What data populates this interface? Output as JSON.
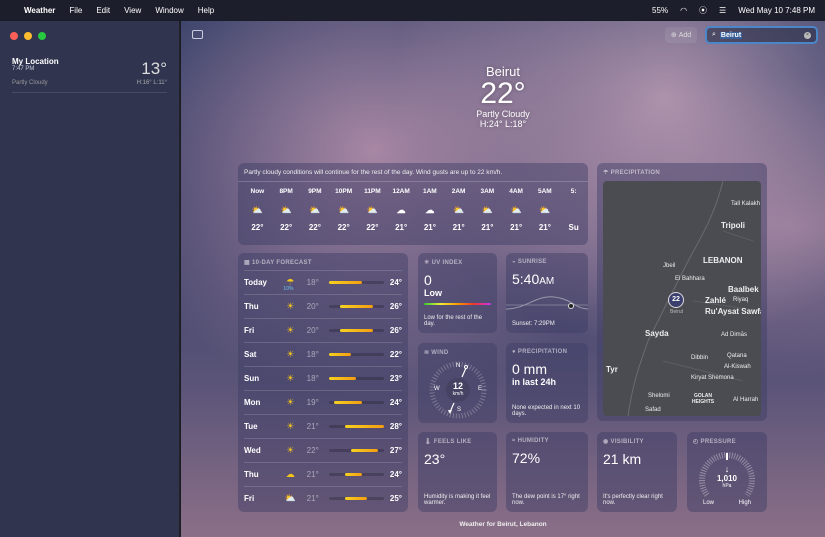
{
  "menubar": {
    "app": "Weather",
    "items": [
      "File",
      "Edit",
      "View",
      "Window",
      "Help"
    ],
    "battery": "55%",
    "datetime": "Wed May 10  7:48 PM"
  },
  "sidebar": {
    "location": {
      "name": "My Location",
      "time": "7:47 PM",
      "condition": "Partly Cloudy",
      "temp": "13°",
      "hilo": "H:16°  L:11°"
    }
  },
  "toolbar": {
    "add_label": "Add",
    "search_value": "Beirut"
  },
  "hero": {
    "city": "Beirut",
    "temp": "22°",
    "condition": "Partly Cloudy",
    "hilo": "H:24°  L:18°"
  },
  "hourly": {
    "summary": "Partly cloudy conditions will continue for the rest of the day. Wind gusts are up to 22 km/h.",
    "hours": [
      {
        "t": "Now",
        "i": "partly-cloudy",
        "v": "22°"
      },
      {
        "t": "8PM",
        "i": "partly-cloudy",
        "v": "22°"
      },
      {
        "t": "9PM",
        "i": "partly-cloudy",
        "v": "22°"
      },
      {
        "t": "10PM",
        "i": "partly-cloudy",
        "v": "22°"
      },
      {
        "t": "11PM",
        "i": "partly-cloudy",
        "v": "22°"
      },
      {
        "t": "12AM",
        "i": "cloudy",
        "v": "21°"
      },
      {
        "t": "1AM",
        "i": "cloudy",
        "v": "21°"
      },
      {
        "t": "2AM",
        "i": "partly-cloudy",
        "v": "21°"
      },
      {
        "t": "3AM",
        "i": "partly-cloudy",
        "v": "21°"
      },
      {
        "t": "4AM",
        "i": "partly-cloudy",
        "v": "21°"
      },
      {
        "t": "5AM",
        "i": "partly-cloudy",
        "v": "21°"
      },
      {
        "t": "5:",
        "i": "",
        "v": "Su"
      }
    ]
  },
  "forecast": {
    "title": "10-DAY FORECAST",
    "days": [
      {
        "d": "Today",
        "i": "rain",
        "p": "10%",
        "lo": 18,
        "hi": 24,
        "lo_s": "18°",
        "hi_s": "24°"
      },
      {
        "d": "Thu",
        "i": "sun",
        "lo": 20,
        "hi": 26,
        "lo_s": "20°",
        "hi_s": "26°"
      },
      {
        "d": "Fri",
        "i": "sun",
        "lo": 20,
        "hi": 26,
        "lo_s": "20°",
        "hi_s": "26°"
      },
      {
        "d": "Sat",
        "i": "sun",
        "lo": 18,
        "hi": 22,
        "lo_s": "18°",
        "hi_s": "22°"
      },
      {
        "d": "Sun",
        "i": "sun",
        "lo": 18,
        "hi": 23,
        "lo_s": "18°",
        "hi_s": "23°"
      },
      {
        "d": "Mon",
        "i": "sun",
        "lo": 19,
        "hi": 24,
        "lo_s": "19°",
        "hi_s": "24°"
      },
      {
        "d": "Tue",
        "i": "sun",
        "lo": 21,
        "hi": 28,
        "lo_s": "21°",
        "hi_s": "28°"
      },
      {
        "d": "Wed",
        "i": "sun",
        "lo": 22,
        "hi": 27,
        "lo_s": "22°",
        "hi_s": "27°"
      },
      {
        "d": "Thu",
        "i": "cloudy",
        "lo": 21,
        "hi": 24,
        "lo_s": "21°",
        "hi_s": "24°"
      },
      {
        "d": "Fri",
        "i": "partly-sunny",
        "lo": 21,
        "hi": 25,
        "lo_s": "21°",
        "hi_s": "25°"
      }
    ]
  },
  "uv": {
    "title": "UV INDEX",
    "value": "0",
    "level": "Low",
    "note": "Low for the rest of the day."
  },
  "sunrise": {
    "title": "SUNRISE",
    "time": "5:40",
    "ampm": "AM",
    "sunset": "Sunset: 7:29PM"
  },
  "wind": {
    "title": "WIND",
    "speed": "12",
    "unit": "km/h",
    "n": "N",
    "e": "E",
    "s": "S",
    "w": "W"
  },
  "precipitation": {
    "title": "PRECIPITATION",
    "value": "0 mm",
    "sub": "in last 24h",
    "note": "None expected in next 10 days."
  },
  "map": {
    "title": "PRECIPITATION",
    "pin_temp": "22",
    "pin_city": "Beirut",
    "labels": [
      "Tall Kalakh",
      "Tripoli",
      "LEBANON",
      "Jbeil",
      "El Bahhara",
      "Baalbek",
      "Zahlé",
      "Riyaq",
      "Ru'Aysat Sawfar",
      "Sayda",
      "Ad Dimās",
      "Tyr",
      "Dibbin",
      "Qatana",
      "Al-Kiswah",
      "Kiryat Shemona",
      "Shelomi",
      "GOLAN HEIGHTS",
      "Safad",
      "Al Harrah"
    ]
  },
  "feels": {
    "title": "FEELS LIKE",
    "value": "23°",
    "note": "Humidity is making it feel warmer."
  },
  "humidity": {
    "title": "HUMIDITY",
    "value": "72%",
    "note": "The dew point is 17° right now."
  },
  "visibility": {
    "title": "VISIBILITY",
    "value": "21 km",
    "note": "It's perfectly clear right now."
  },
  "pressure": {
    "title": "PRESSURE",
    "value": "1,010",
    "unit": "hPa",
    "low": "Low",
    "high": "High"
  },
  "footer": "Weather for Beirut, Lebanon"
}
